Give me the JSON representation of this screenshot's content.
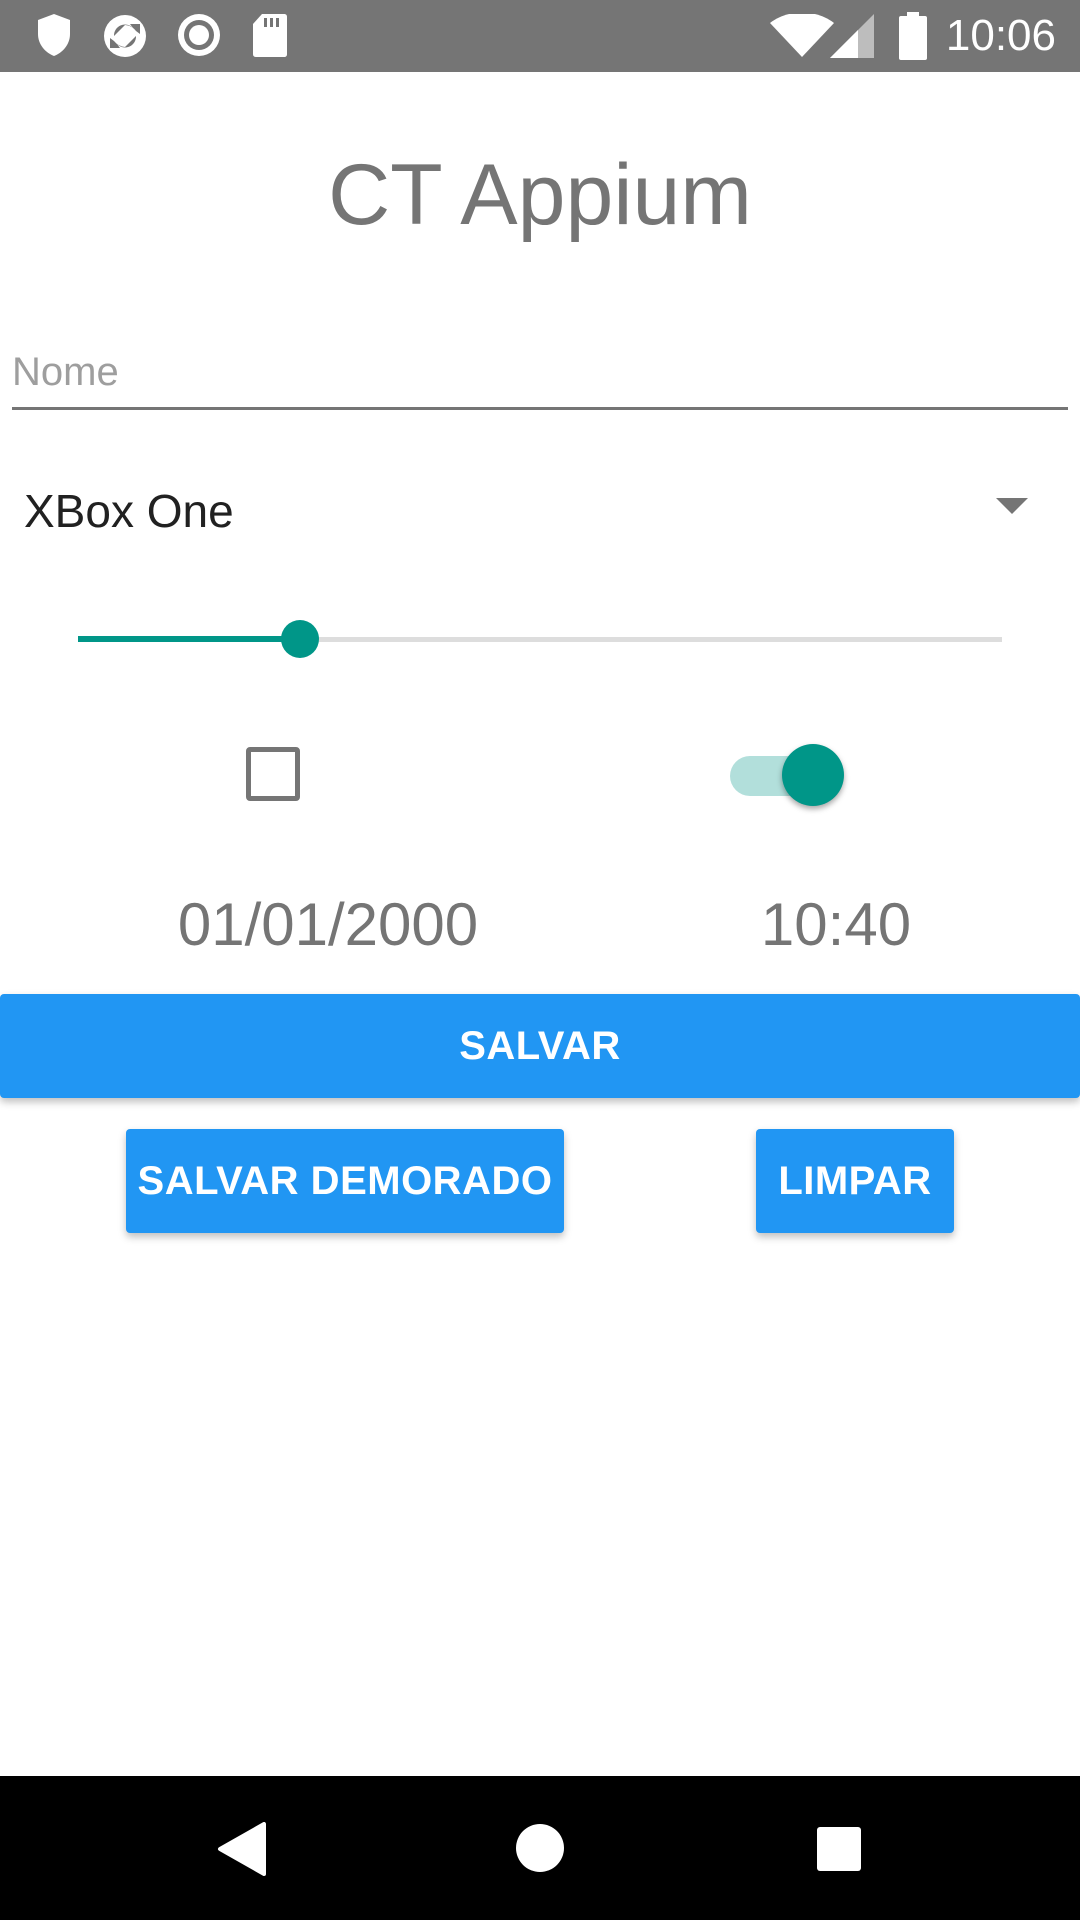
{
  "status_bar": {
    "time": "10:06",
    "icons": [
      "shield-icon",
      "refresh-icon",
      "record-icon",
      "sd-card-icon",
      "wifi-icon",
      "signal-icon",
      "battery-icon"
    ]
  },
  "app": {
    "title": "CT Appium"
  },
  "form": {
    "name_placeholder": "Nome",
    "name_value": "",
    "console_selected": "XBox One",
    "slider_value_fraction": 0.24,
    "checkbox_checked": false,
    "switch_on": true,
    "date": "01/01/2000",
    "time": "10:40"
  },
  "buttons": {
    "save": "SALVAR",
    "save_slow": "SALVAR DEMORADO",
    "clear": "LIMPAR"
  },
  "nav_bar": {
    "icons": [
      "back-icon",
      "home-icon",
      "recents-icon"
    ]
  },
  "colors": {
    "accent": "#009688",
    "button": "#2196f3",
    "status_bar": "#757575"
  }
}
